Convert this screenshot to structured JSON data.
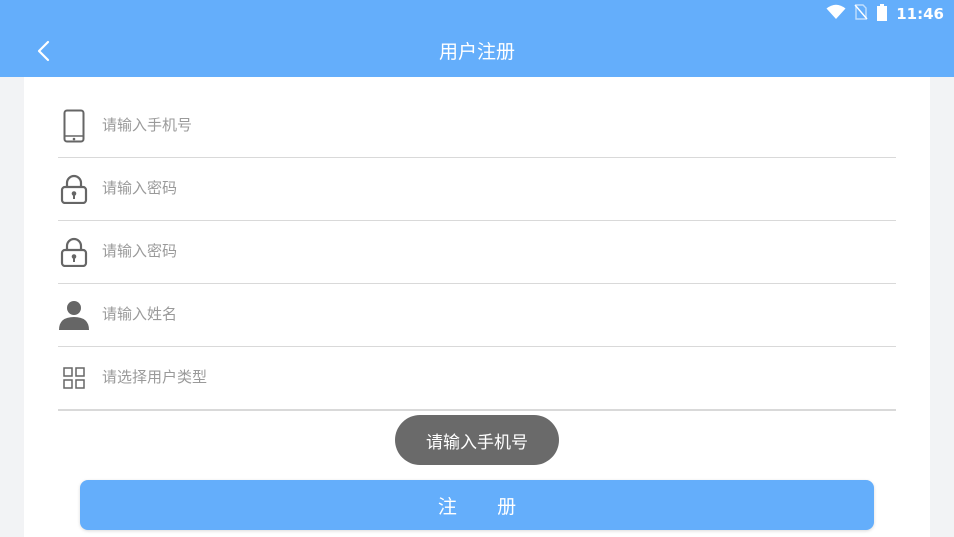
{
  "status_bar": {
    "time": "11:46"
  },
  "header": {
    "title": "用户注册"
  },
  "form": {
    "phone_placeholder": "请输入手机号",
    "password_placeholder": "请输入密码",
    "confirm_password_placeholder": "请输入密码",
    "name_placeholder": "请输入姓名",
    "user_type_placeholder": "请选择用户类型"
  },
  "toast": {
    "message": "请输入手机号"
  },
  "register_button": {
    "label": "注 册"
  },
  "colors": {
    "primary": "#64aefb",
    "toast_bg": "#6a6a6a",
    "icon": "#666666"
  }
}
